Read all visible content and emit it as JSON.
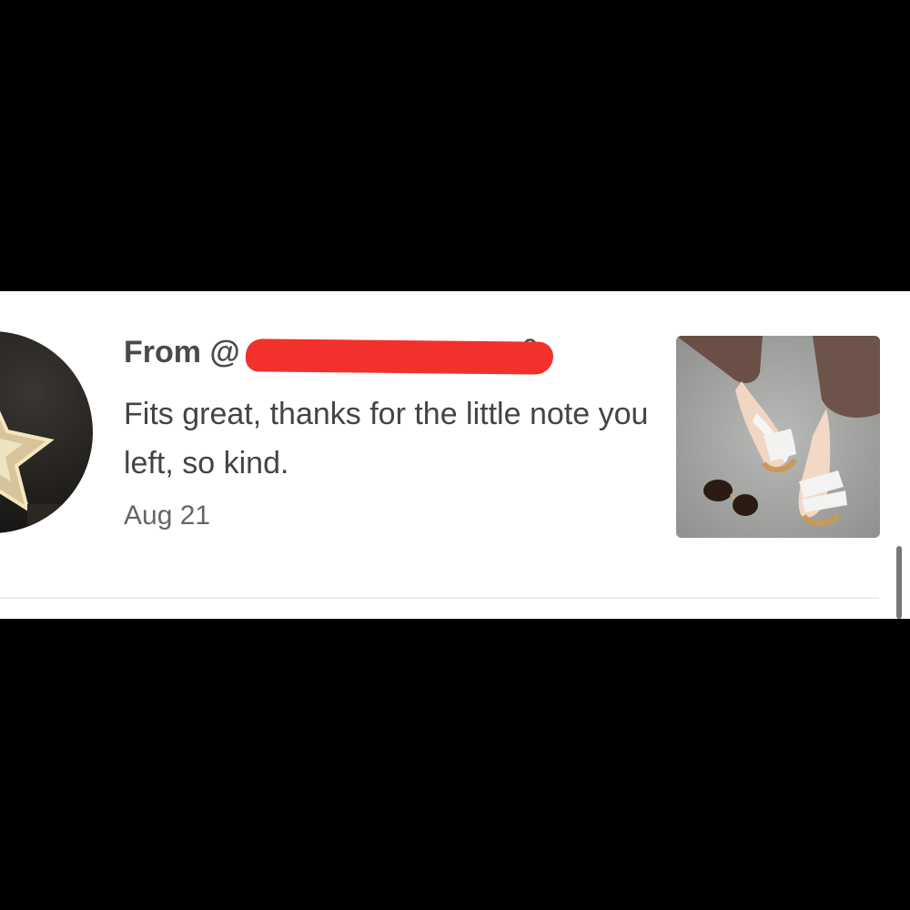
{
  "review": {
    "from_prefix": "From @",
    "handle_visible_suffix": "oo0",
    "text": "Fits great, thanks for the little note you left, so kind.",
    "date": "Aug 21"
  },
  "colors": {
    "redaction": "#f2302c",
    "text": "#4a4a4a",
    "background_band": "#000000"
  },
  "icons": {
    "avatar": "star-avatar-image",
    "photo": "review-photo-sandals"
  }
}
